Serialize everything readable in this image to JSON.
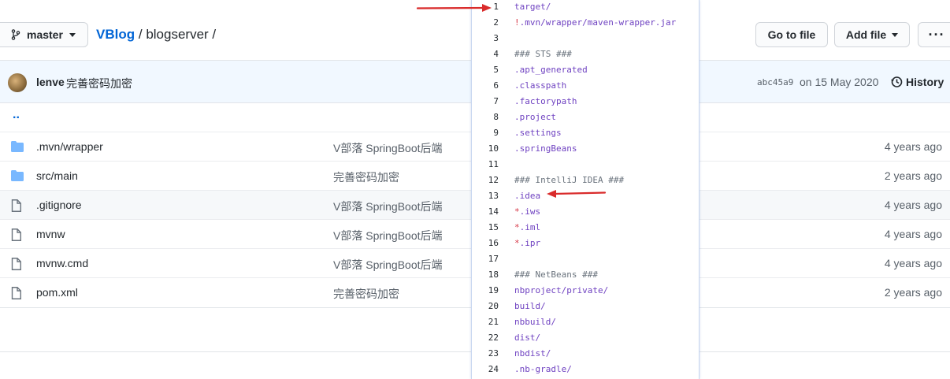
{
  "header": {
    "branch": "master",
    "repo": "VBlog",
    "sep1": "/",
    "folder": "blogserver",
    "sep2": "/",
    "go_to_file": "Go to file",
    "add_file": "Add file",
    "more": "···"
  },
  "commit": {
    "user": "lenve",
    "message": "完善密码加密",
    "sha": "abc45a9",
    "date": "on 15 May 2020",
    "history": "History"
  },
  "parent_dir": "..",
  "files": [
    {
      "type": "dir",
      "name": ".mvn/wrapper",
      "message": "V部落 SpringBoot后端",
      "age": "4 years ago"
    },
    {
      "type": "dir",
      "name": "src/main",
      "message": "完善密码加密",
      "age": "2 years ago"
    },
    {
      "type": "file",
      "name": ".gitignore",
      "message": "V部落 SpringBoot后端",
      "age": "4 years ago"
    },
    {
      "type": "file",
      "name": "mvnw",
      "message": "V部落 SpringBoot后端",
      "age": "4 years ago"
    },
    {
      "type": "file",
      "name": "mvnw.cmd",
      "message": "V部落 SpringBoot后端",
      "age": "4 years ago"
    },
    {
      "type": "file",
      "name": "pom.xml",
      "message": "完善密码加密",
      "age": "2 years ago"
    }
  ],
  "gitignore": [
    {
      "n": "1",
      "text": "target/"
    },
    {
      "n": "2",
      "text": "!.mvn/wrapper/maven-wrapper.jar"
    },
    {
      "n": "3",
      "text": ""
    },
    {
      "n": "4",
      "text": "### STS ###"
    },
    {
      "n": "5",
      "text": ".apt_generated"
    },
    {
      "n": "6",
      "text": ".classpath"
    },
    {
      "n": "7",
      "text": ".factorypath"
    },
    {
      "n": "8",
      "text": ".project"
    },
    {
      "n": "9",
      "text": ".settings"
    },
    {
      "n": "10",
      "text": ".springBeans"
    },
    {
      "n": "11",
      "text": ""
    },
    {
      "n": "12",
      "text": "### IntelliJ IDEA ###"
    },
    {
      "n": "13",
      "text": ".idea"
    },
    {
      "n": "14",
      "text": "*.iws"
    },
    {
      "n": "15",
      "text": "*.iml"
    },
    {
      "n": "16",
      "text": "*.ipr"
    },
    {
      "n": "17",
      "text": ""
    },
    {
      "n": "18",
      "text": "### NetBeans ###"
    },
    {
      "n": "19",
      "text": "nbproject/private/"
    },
    {
      "n": "20",
      "text": "build/"
    },
    {
      "n": "21",
      "text": "nbbuild/"
    },
    {
      "n": "22",
      "text": "dist/"
    },
    {
      "n": "23",
      "text": "nbdist/"
    },
    {
      "n": "24",
      "text": ".nb-gradle/"
    }
  ],
  "colors": {
    "link": "#0366d6",
    "folder_icon": "#79b8ff",
    "annotation_arrow": "#d92b2b"
  }
}
